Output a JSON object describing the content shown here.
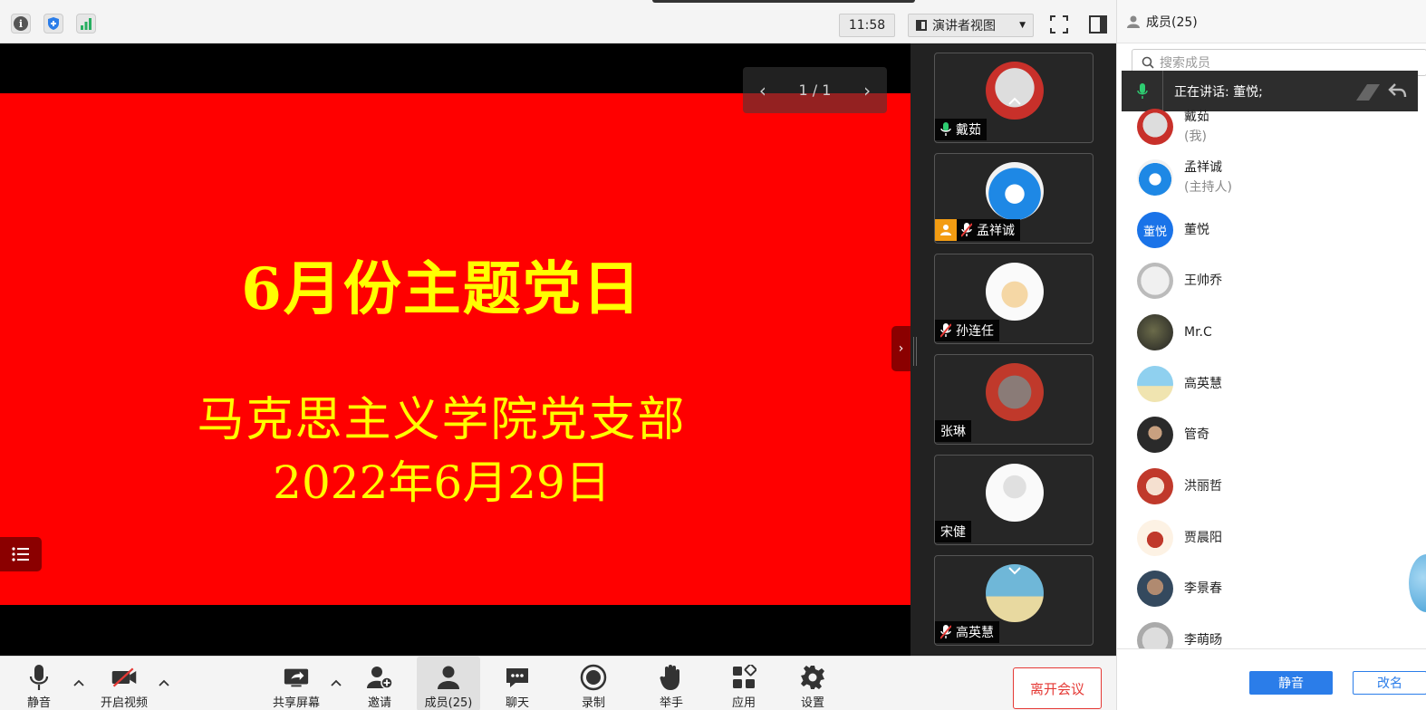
{
  "topbar": {
    "time": "11:58",
    "view_label": "演讲者视图"
  },
  "slide": {
    "title": "6月份主题党日",
    "org": "马克思主义学院党支部",
    "date": "2022年6月29日",
    "page_indicator": "1 / 1"
  },
  "video_tiles": [
    {
      "name": "戴茹"
    },
    {
      "name": "孟祥诚"
    },
    {
      "name": "孙连任"
    },
    {
      "name": "张琳"
    },
    {
      "name": "宋健"
    },
    {
      "name": "高英慧"
    }
  ],
  "panel": {
    "title": "成员(25)",
    "search_placeholder": "搜索成员",
    "speaking_text": "正在讲话: 董悦;",
    "members": [
      {
        "name": "戴茹",
        "sub": "(我)"
      },
      {
        "name": "孟祥诚",
        "sub": "(主持人)"
      },
      {
        "name": "董悦",
        "avatar_text": "董悦"
      },
      {
        "name": "王帅乔"
      },
      {
        "name": "Mr.C"
      },
      {
        "name": "高英慧"
      },
      {
        "name": "管奇"
      },
      {
        "name": "洪丽哲"
      },
      {
        "name": "贾晨阳"
      },
      {
        "name": "李景春"
      },
      {
        "name": "李萌旸"
      }
    ],
    "mute_all": "静音",
    "rename": "改名"
  },
  "toolbar": {
    "mute": "静音",
    "video": "开启视频",
    "share": "共享屏幕",
    "invite": "邀请",
    "members": "成员(25)",
    "chat": "聊天",
    "record": "录制",
    "raise_hand": "举手",
    "apps": "应用",
    "settings": "设置",
    "leave": "离开会议"
  },
  "colors": {
    "slide_bg": "#ff0000",
    "slide_text": "#ffff00",
    "accent": "#2b7de9",
    "leave": "#e53935"
  }
}
